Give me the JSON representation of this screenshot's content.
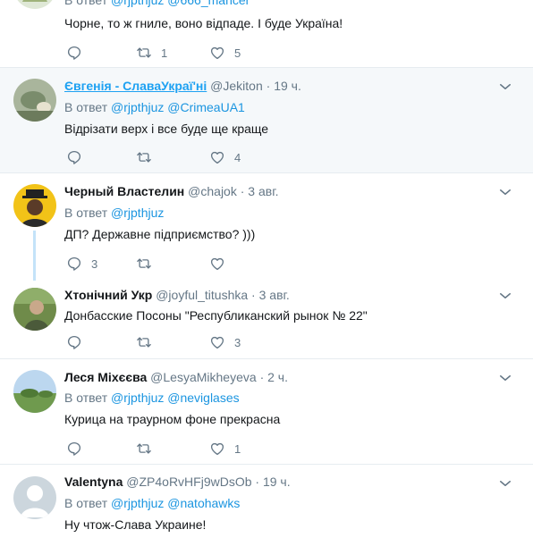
{
  "tweets": [
    {
      "reply_prefix": "В ответ",
      "mentions": "@rjpthjuz @666_mancer",
      "text": "Чорне, то ж гниле, воно відпаде. І буде Україна!",
      "actions": {
        "reply": "",
        "retweet": "1",
        "like": "5"
      }
    },
    {
      "name": "Євгенія - СлаваУкраї'ні",
      "handle": "@Jekiton",
      "time": "19 ч.",
      "reply_prefix": "В ответ",
      "mentions": "@rjpthjuz @CrimeaUA1",
      "text": "Відрізати верх і все буде ще краще",
      "actions": {
        "reply": "",
        "retweet": "",
        "like": "4"
      }
    },
    {
      "name": "Черный Властелин",
      "handle": "@chajok",
      "time": "3 авг.",
      "reply_prefix": "В ответ",
      "mentions": "@rjpthjuz",
      "text": "ДП? Державне підприємство? )))",
      "actions": {
        "reply": "3",
        "retweet": "",
        "like": ""
      }
    },
    {
      "name": "Хтонічний Укр",
      "handle": "@joyful_titushka",
      "time": "3 авг.",
      "text": "Донбасские Посоны \"Республиканский рынок № 22\"",
      "actions": {
        "reply": "",
        "retweet": "",
        "like": "3"
      }
    },
    {
      "name": "Леся Міхєєва",
      "handle": "@LesyaMikheyeva",
      "time": "2 ч.",
      "reply_prefix": "В ответ",
      "mentions": "@rjpthjuz @neviglases",
      "text": "Курица на траурном фоне прекрасна",
      "actions": {
        "reply": "",
        "retweet": "",
        "like": "1"
      }
    },
    {
      "name": "Valentyna",
      "handle": "@ZP4oRvHFj9wDsOb",
      "time": "19 ч.",
      "reply_prefix": "В ответ",
      "mentions": "@rjpthjuz @natohawks",
      "text": "Ну чтож-Слава Украине!"
    }
  ],
  "dot": "·",
  "icons": {
    "reply": "reply-icon",
    "retweet": "retweet-icon",
    "like": "heart-icon",
    "menu": "chevron-down-icon"
  },
  "colors": {
    "link": "#1b95e0",
    "muted": "#657786",
    "thread_line": "#c4e3f9",
    "highlight_bg": "#f5f8fa"
  }
}
